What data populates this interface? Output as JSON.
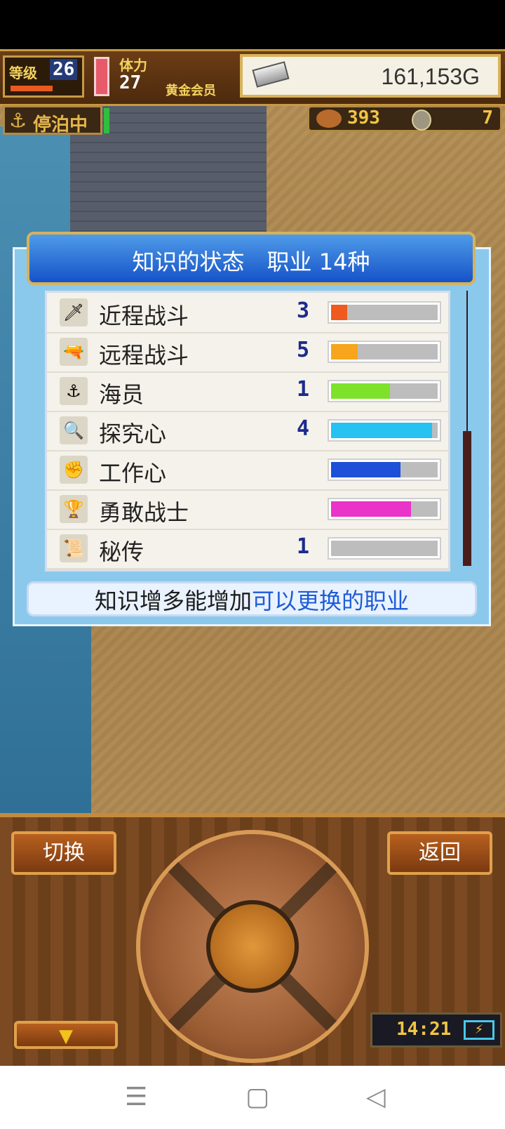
{
  "hud": {
    "level_label": "等级",
    "level": "26",
    "stamina_label": "体力",
    "stamina": "27",
    "membership": "黄金会员",
    "gold": "161,153G",
    "moor_label": "停泊中",
    "food": "393",
    "medals": "7"
  },
  "panel": {
    "title": "知识的状态　职业 14种",
    "skills": [
      {
        "name": "近程战斗",
        "icon": "sword-icon",
        "level": "3",
        "progress": 0.15,
        "color": "#ef5a1e"
      },
      {
        "name": "远程战斗",
        "icon": "cannon-icon",
        "level": "5",
        "progress": 0.25,
        "color": "#f6a51d"
      },
      {
        "name": "海员",
        "icon": "anchor-icon",
        "level": "1",
        "progress": 0.55,
        "color": "#7ee22a"
      },
      {
        "name": "探究心",
        "icon": "magnifier-icon",
        "level": "4",
        "progress": 0.95,
        "color": "#25c2f2"
      },
      {
        "name": "工作心",
        "icon": "fist-icon",
        "level": "",
        "progress": 0.65,
        "color": "#1d4fd8"
      },
      {
        "name": "勇敢战士",
        "icon": "trophy-icon",
        "level": "",
        "progress": 0.75,
        "color": "#ea33c8"
      },
      {
        "name": "秘传",
        "icon": "scroll-icon",
        "level": "1",
        "progress": 0.0,
        "color": "#888888"
      }
    ],
    "hint_black": "知识增多能增加",
    "hint_blue": "可以更换的职业",
    "scroll_position": 0.5
  },
  "controls": {
    "switch_label": "切换",
    "back_label": "返回",
    "time": "14:21"
  },
  "colors": {
    "hint_blue": "#1e5bd8",
    "title_blue": "#1553c8",
    "gold_text": "#f1c544"
  }
}
